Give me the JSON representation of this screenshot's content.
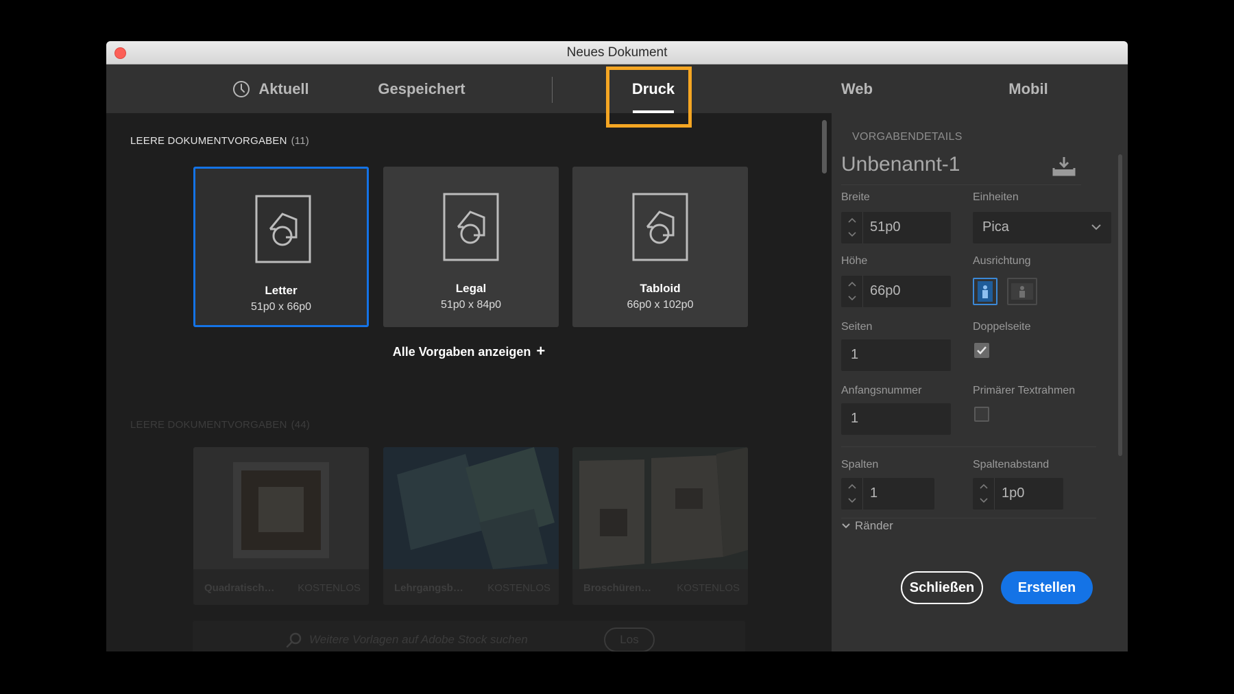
{
  "window": {
    "title": "Neues Dokument"
  },
  "tabs": [
    {
      "label": "Aktuell",
      "icon": "clock-icon"
    },
    {
      "label": "Gespeichert"
    },
    {
      "label": "Druck",
      "active": true
    },
    {
      "label": "Web"
    },
    {
      "label": "Mobil"
    }
  ],
  "blank_presets": {
    "heading": "LEERE DOKUMENTVORGABEN",
    "count": "(11)",
    "items": [
      {
        "name": "Letter",
        "size": "51p0 x 66p0",
        "selected": true
      },
      {
        "name": "Legal",
        "size": "51p0 x 84p0"
      },
      {
        "name": "Tabloid",
        "size": "66p0 x 102p0"
      }
    ],
    "show_all": "Alle Vorgaben anzeigen"
  },
  "templates": {
    "heading": "LEERE DOKUMENTVORGABEN",
    "count": "(44)",
    "items": [
      {
        "name": "Quadratisch…",
        "price": "KOSTENLOS"
      },
      {
        "name": "Lehrgangsb…",
        "price": "KOSTENLOS"
      },
      {
        "name": "Broschüren…",
        "price": "KOSTENLOS"
      }
    ]
  },
  "search": {
    "placeholder": "Weitere Vorlagen auf Adobe Stock suchen",
    "go_label": "Los"
  },
  "details": {
    "heading": "VORGABENDETAILS",
    "doc_name": "Unbenannt-1",
    "width_label": "Breite",
    "width_value": "51p0",
    "units_label": "Einheiten",
    "units_value": "Pica",
    "height_label": "Höhe",
    "height_value": "66p0",
    "orientation_label": "Ausrichtung",
    "pages_label": "Seiten",
    "pages_value": "1",
    "facing_label": "Doppelseite",
    "facing_checked": true,
    "start_label": "Anfangsnummer",
    "start_value": "1",
    "primary_frame_label": "Primärer Textrahmen",
    "primary_frame_checked": false,
    "columns_label": "Spalten",
    "columns_value": "1",
    "gutter_label": "Spaltenabstand",
    "gutter_value": "1p0",
    "margins_label": "Ränder"
  },
  "actions": {
    "close_label": "Schließen",
    "create_label": "Erstellen"
  },
  "colors": {
    "accent": "#1473e6",
    "highlight": "#f5a623"
  }
}
